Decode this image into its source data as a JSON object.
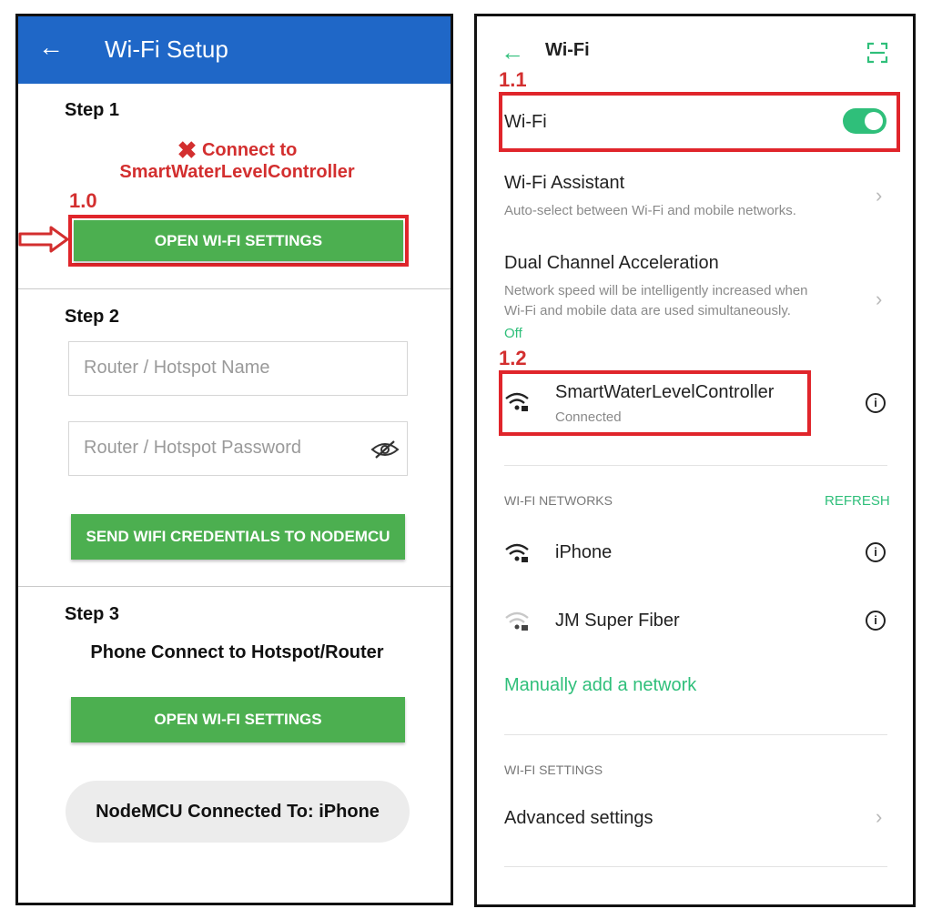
{
  "left": {
    "header": {
      "title": "Wi-Fi Setup"
    },
    "step1": {
      "label": "Step 1",
      "status_line1": "Connect to",
      "status_line2": "SmartWaterLevelController",
      "annotation": "1.0",
      "button": "OPEN WI-FI SETTINGS"
    },
    "step2": {
      "label": "Step 2",
      "name_placeholder": "Router / Hotspot Name",
      "password_placeholder": "Router / Hotspot Password",
      "send_button": "SEND WIFI CREDENTIALS TO NODEMCU"
    },
    "step3": {
      "label": "Step 3",
      "desc": "Phone Connect to Hotspot/Router",
      "button": "OPEN WI-FI SETTINGS",
      "status": "NodeMCU Connected To: iPhone"
    }
  },
  "right": {
    "header": {
      "title": "Wi-Fi"
    },
    "annotation_11": "1.1",
    "annotation_12": "1.2",
    "wifi_toggle": {
      "label": "Wi-Fi",
      "on": true
    },
    "assistant": {
      "title": "Wi-Fi Assistant",
      "subtitle": "Auto-select between Wi-Fi and mobile networks."
    },
    "dual": {
      "title": "Dual Channel Acceleration",
      "line1": "Network speed will be intelligently increased when",
      "line2": "Wi-Fi and mobile data are used simultaneously.",
      "state": "Off"
    },
    "connected": {
      "name": "SmartWaterLevelController",
      "status": "Connected"
    },
    "networks": {
      "header": "WI-FI NETWORKS",
      "refresh": "REFRESH",
      "items": [
        {
          "name": "iPhone"
        },
        {
          "name": "JM Super Fiber"
        }
      ]
    },
    "manual_add": "Manually add a network",
    "settings_header": "WI-FI SETTINGS",
    "advanced": "Advanced settings"
  },
  "colors": {
    "header_blue": "#1f67c7",
    "green": "#4caf50",
    "teal": "#2fbf7a",
    "annotation_red": "#d32f2f"
  }
}
